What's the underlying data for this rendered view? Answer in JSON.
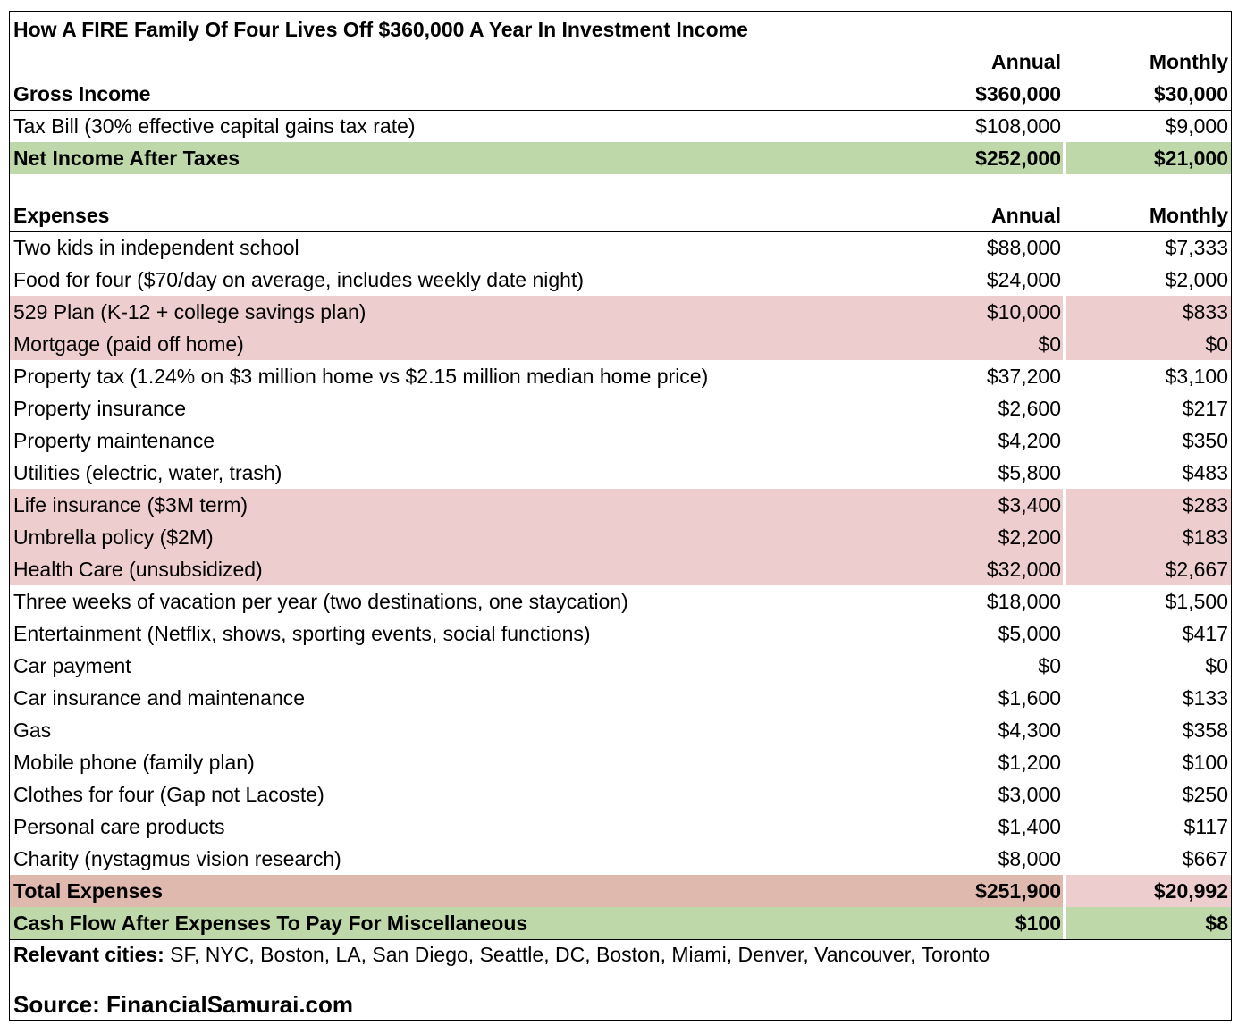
{
  "title": "How A FIRE Family Of Four Lives Off $360,000 A Year In Investment Income",
  "income": {
    "header_annual": "Annual",
    "header_monthly": "Monthly",
    "gross": {
      "label": "Gross Income",
      "annual": "$360,000",
      "monthly": "$30,000"
    },
    "tax": {
      "label": "Tax Bill (30% effective capital gains tax rate)",
      "annual": "$108,000",
      "monthly": "$9,000"
    },
    "net": {
      "label": "Net Income After Taxes",
      "annual": "$252,000",
      "monthly": "$21,000"
    }
  },
  "expenses": {
    "header": {
      "label": "Expenses",
      "annual": "Annual",
      "monthly": "Monthly"
    },
    "rows": [
      {
        "label": "Two kids in independent school",
        "annual": "$88,000",
        "monthly": "$7,333",
        "highlight": "none"
      },
      {
        "label": "Food for four ($70/day on average, includes weekly date night)",
        "annual": "$24,000",
        "monthly": "$2,000",
        "highlight": "none"
      },
      {
        "label": "529 Plan (K-12 + college savings plan)",
        "annual": "$10,000",
        "monthly": "$833",
        "highlight": "pink"
      },
      {
        "label": "Mortgage (paid off home)",
        "annual": "$0",
        "monthly": "$0",
        "highlight": "pink"
      },
      {
        "label": "Property tax (1.24% on $3 million home vs $2.15 million median home price)",
        "annual": "$37,200",
        "monthly": "$3,100",
        "highlight": "none"
      },
      {
        "label": "Property insurance",
        "annual": "$2,600",
        "monthly": "$217",
        "highlight": "none"
      },
      {
        "label": "Property maintenance",
        "annual": "$4,200",
        "monthly": "$350",
        "highlight": "none"
      },
      {
        "label": "Utilities (electric, water, trash)",
        "annual": "$5,800",
        "monthly": "$483",
        "highlight": "none"
      },
      {
        "label": "Life insurance ($3M term)",
        "annual": "$3,400",
        "monthly": "$283",
        "highlight": "pink"
      },
      {
        "label": "Umbrella policy ($2M)",
        "annual": "$2,200",
        "monthly": "$183",
        "highlight": "pink"
      },
      {
        "label": "Health Care (unsubsidized)",
        "annual": "$32,000",
        "monthly": "$2,667",
        "highlight": "pink"
      },
      {
        "label": "Three weeks of vacation per year (two destinations, one staycation)",
        "annual": "$18,000",
        "monthly": "$1,500",
        "highlight": "none"
      },
      {
        "label": "Entertainment (Netflix, shows, sporting events, social functions)",
        "annual": "$5,000",
        "monthly": "$417",
        "highlight": "none"
      },
      {
        "label": "Car payment",
        "annual": "$0",
        "monthly": "$0",
        "highlight": "none"
      },
      {
        "label": "Car insurance and maintenance",
        "annual": "$1,600",
        "monthly": "$133",
        "highlight": "none"
      },
      {
        "label": "Gas",
        "annual": "$4,300",
        "monthly": "$358",
        "highlight": "none"
      },
      {
        "label": "Mobile phone (family plan)",
        "annual": "$1,200",
        "monthly": "$100",
        "highlight": "none"
      },
      {
        "label": "Clothes for four (Gap not Lacoste)",
        "annual": "$3,000",
        "monthly": "$250",
        "highlight": "none"
      },
      {
        "label": "Personal care products",
        "annual": "$1,400",
        "monthly": "$117",
        "highlight": "none"
      },
      {
        "label": "Charity (nystagmus vision research)",
        "annual": "$8,000",
        "monthly": "$667",
        "highlight": "none"
      }
    ],
    "total": {
      "label": "Total Expenses",
      "annual": "$251,900",
      "monthly": "$20,992"
    },
    "cashflow": {
      "label": "Cash Flow After Expenses To Pay For Miscellaneous",
      "annual": "$100",
      "monthly": "$8"
    }
  },
  "footer": {
    "cities_label": "Relevant cities:",
    "cities": " SF, NYC, Boston, LA, San Diego, Seattle, DC, Boston, Miami, Denver, Vancouver, Toronto",
    "source": "Source: FinancialSamurai.com"
  },
  "colors": {
    "green": "#bfd8aa",
    "pink": "#edcdcd",
    "salmon": "#e0b9ae"
  }
}
